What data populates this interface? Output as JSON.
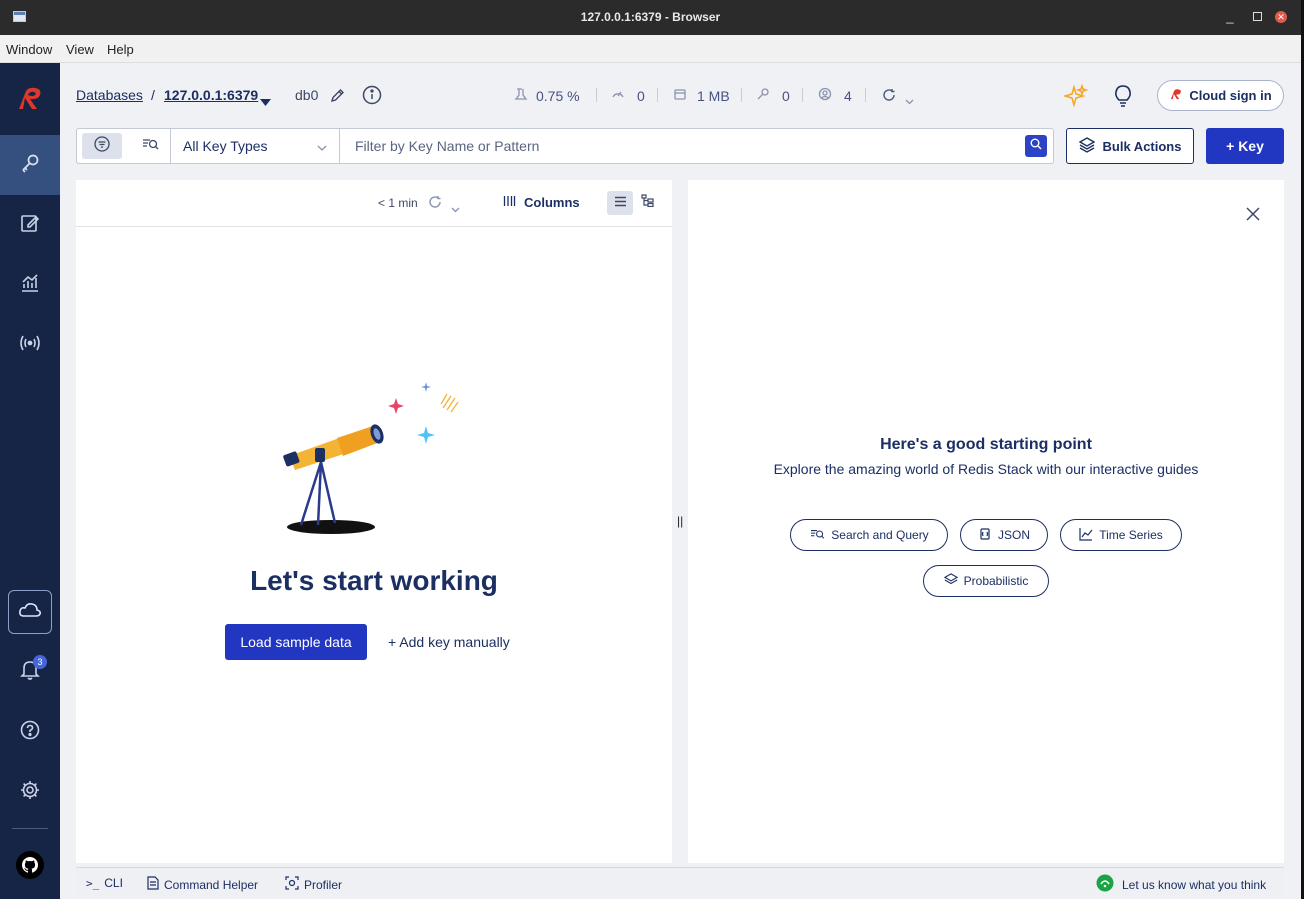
{
  "window": {
    "title": "127.0.0.1:6379 - Browser"
  },
  "menu": [
    "Window",
    "View",
    "Help"
  ],
  "breadcrumb": {
    "databases": "Databases",
    "separator": "/",
    "instance": "127.0.0.1:6379",
    "db": "db0"
  },
  "stats": {
    "cpu": "0.75 %",
    "ops": "0",
    "memory": "1 MB",
    "keys": "0",
    "clients": "4"
  },
  "cloud_signin": "Cloud sign in",
  "filter": {
    "key_type": "All Key Types",
    "placeholder": "Filter by Key Name or Pattern"
  },
  "bulk_actions": "Bulk Actions",
  "add_key": "+ Key",
  "list_header": {
    "refresh_time": "< 1 min",
    "columns": "Columns"
  },
  "empty_state": {
    "title": "Let's start working",
    "load_sample": "Load sample data",
    "add_manually": "+ Add key manually"
  },
  "guides": {
    "title": "Here's a good starting point",
    "subtitle": "Explore the amazing world of Redis Stack with our interactive guides",
    "buttons": [
      "Search and Query",
      "JSON",
      "Time Series",
      "Probabilistic"
    ]
  },
  "notifications_count": "3",
  "bottom": {
    "cli": "CLI",
    "cli_prefix": ">_",
    "helper": "Command Helper",
    "profiler": "Profiler",
    "feedback": "Let us know what you think"
  },
  "colors": {
    "sidebar": "#162545",
    "primary": "#2136c1",
    "text": "#1c2f63",
    "accent_logo": "#dc382c"
  }
}
